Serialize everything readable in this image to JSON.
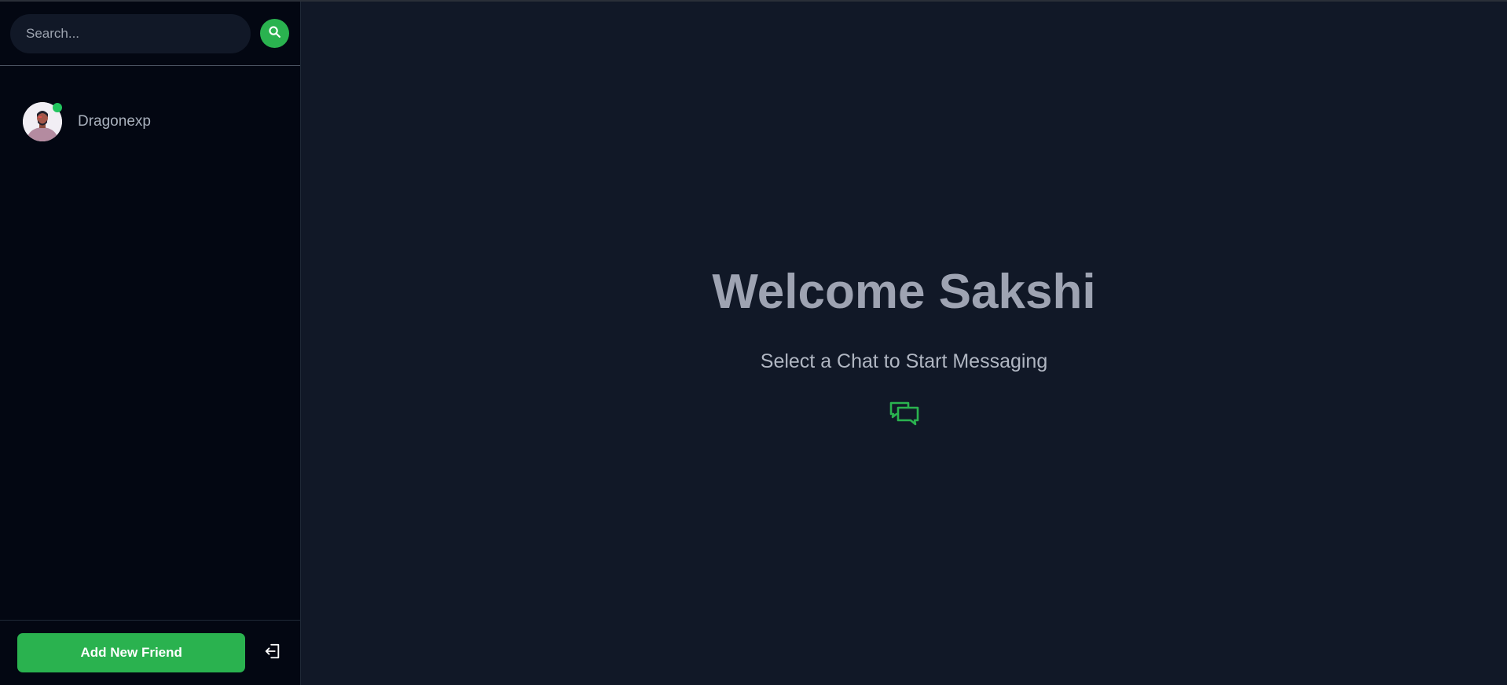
{
  "sidebar": {
    "search": {
      "placeholder": "Search...",
      "value": ""
    },
    "search_button_icon": "search-icon",
    "conversations": [
      {
        "name": "Dragonexp",
        "online": true,
        "avatar_icon": "user-avatar"
      }
    ],
    "footer": {
      "add_friend_label": "Add New Friend",
      "logout_icon": "logout-icon"
    }
  },
  "main": {
    "welcome_title": "Welcome Sakshi",
    "welcome_subtitle": "Select a Chat to Start Messaging",
    "chat_icon": "chat-bubbles-icon"
  },
  "colors": {
    "accent": "#2ab24f",
    "sidebar_bg": "#030712",
    "main_bg": "#111827",
    "online": "#22c55e"
  }
}
